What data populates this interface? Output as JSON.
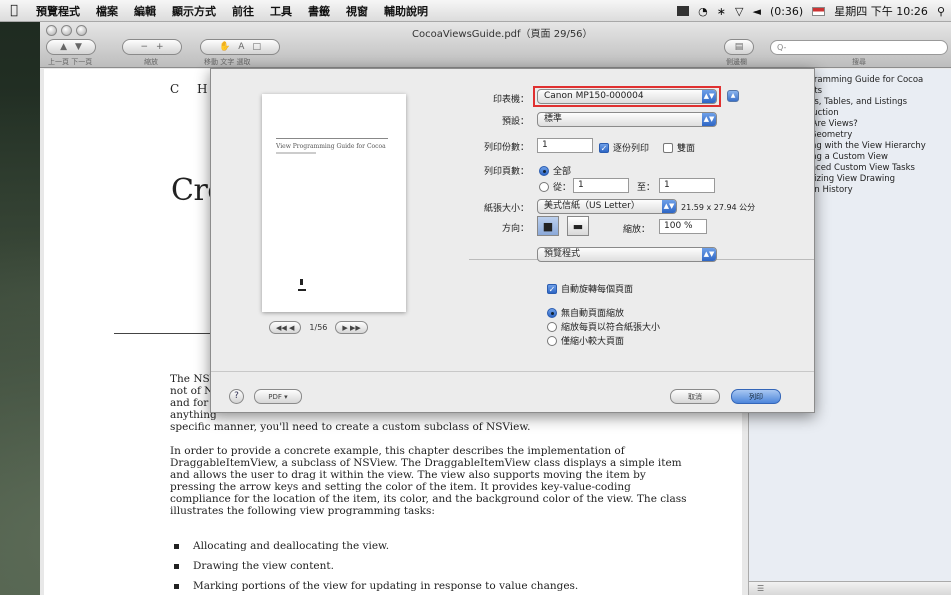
{
  "menubar": {
    "app_icon": "apple-logo-icon",
    "items": [
      "預覽程式",
      "檔案",
      "編輯",
      "顯示方式",
      "前往",
      "工具",
      "書籤",
      "視窗",
      "輔助說明"
    ],
    "status": {
      "battery": "(0:36)",
      "clock": "星期四 下午 10:26"
    }
  },
  "window": {
    "title": "CocoaViewsGuide.pdf（頁面 29/56）",
    "toolbar": {
      "nav_labels": "上一頁 下一頁",
      "zoom_label": "縮放",
      "move_labels": "移動 文字 選取",
      "sidebar_label": "側邊欄",
      "search_placeholder": "Q-",
      "search_label": "搜尋"
    }
  },
  "document": {
    "chapter": "C H A",
    "title_fragment": "Cre",
    "para1_lines": [
      "The NSV",
      "not of N",
      "and for",
      "anything",
      "specific manner, you'll need to create a custom subclass of NSView."
    ],
    "para2": "In order to provide a concrete example, this chapter describes the implementation of DraggableItemView, a subclass of NSView. The DraggableItemView class displays a simple item and allows the user to drag it within the view. The view also supports moving the item by pressing the arrow keys and setting the color of the item. It provides key-value-coding compliance for the location of the item, its color, and the background color of the view. The class illustrates the following view programming tasks:",
    "bullets": [
      "Allocating and deallocating the view.",
      "Drawing the view content.",
      "Marking portions of the view for updating in response to value changes."
    ]
  },
  "sidebar": {
    "toc": [
      "Programming Guide for Cocoa",
      "ntents",
      "gures, Tables, and Listings",
      "troduction",
      "hat Are Views?",
      "ew Geometry",
      "orking with the View Hierarchy",
      "eating a Custom View",
      "dvanced Custom View Tasks",
      "otimizing View Drawing",
      "vision History"
    ]
  },
  "print": {
    "preview_title": "View Programming Guide for Cocoa",
    "pager": {
      "text": "1/56",
      "first": "◀◀",
      "prev": "◀",
      "next": "▶",
      "last": "▶▶"
    },
    "printer_label": "印表機：",
    "printer_value": "Canon MP150-000004",
    "preset_label": "預設：",
    "preset_value": "標準",
    "copies_label": "列印份數：",
    "copies_value": "1",
    "collate_label": "逐份列印",
    "twosided_label": "雙面",
    "pages_label": "列印頁數：",
    "pages_all": "全部",
    "pages_from": "從：",
    "pages_from_value": "1",
    "pages_to": "至：",
    "pages_to_value": "1",
    "paper_label": "紙張大小：",
    "paper_value": "美式信紙（US Letter）",
    "paper_dims": "21.59 x 27.94 公分",
    "orientation_label": "方向：",
    "scale_label": "縮放：",
    "scale_value": "100 %",
    "app_menu": "預覽程式",
    "auto_rotate": "自動旋轉每個頁面",
    "scale_opts": [
      "無自動頁面縮放",
      "縮放每頁以符合紙張大小",
      "僅縮小較大頁面"
    ],
    "help": "?",
    "pdf": "PDF ▾",
    "cancel": "取消",
    "print": "列印"
  }
}
